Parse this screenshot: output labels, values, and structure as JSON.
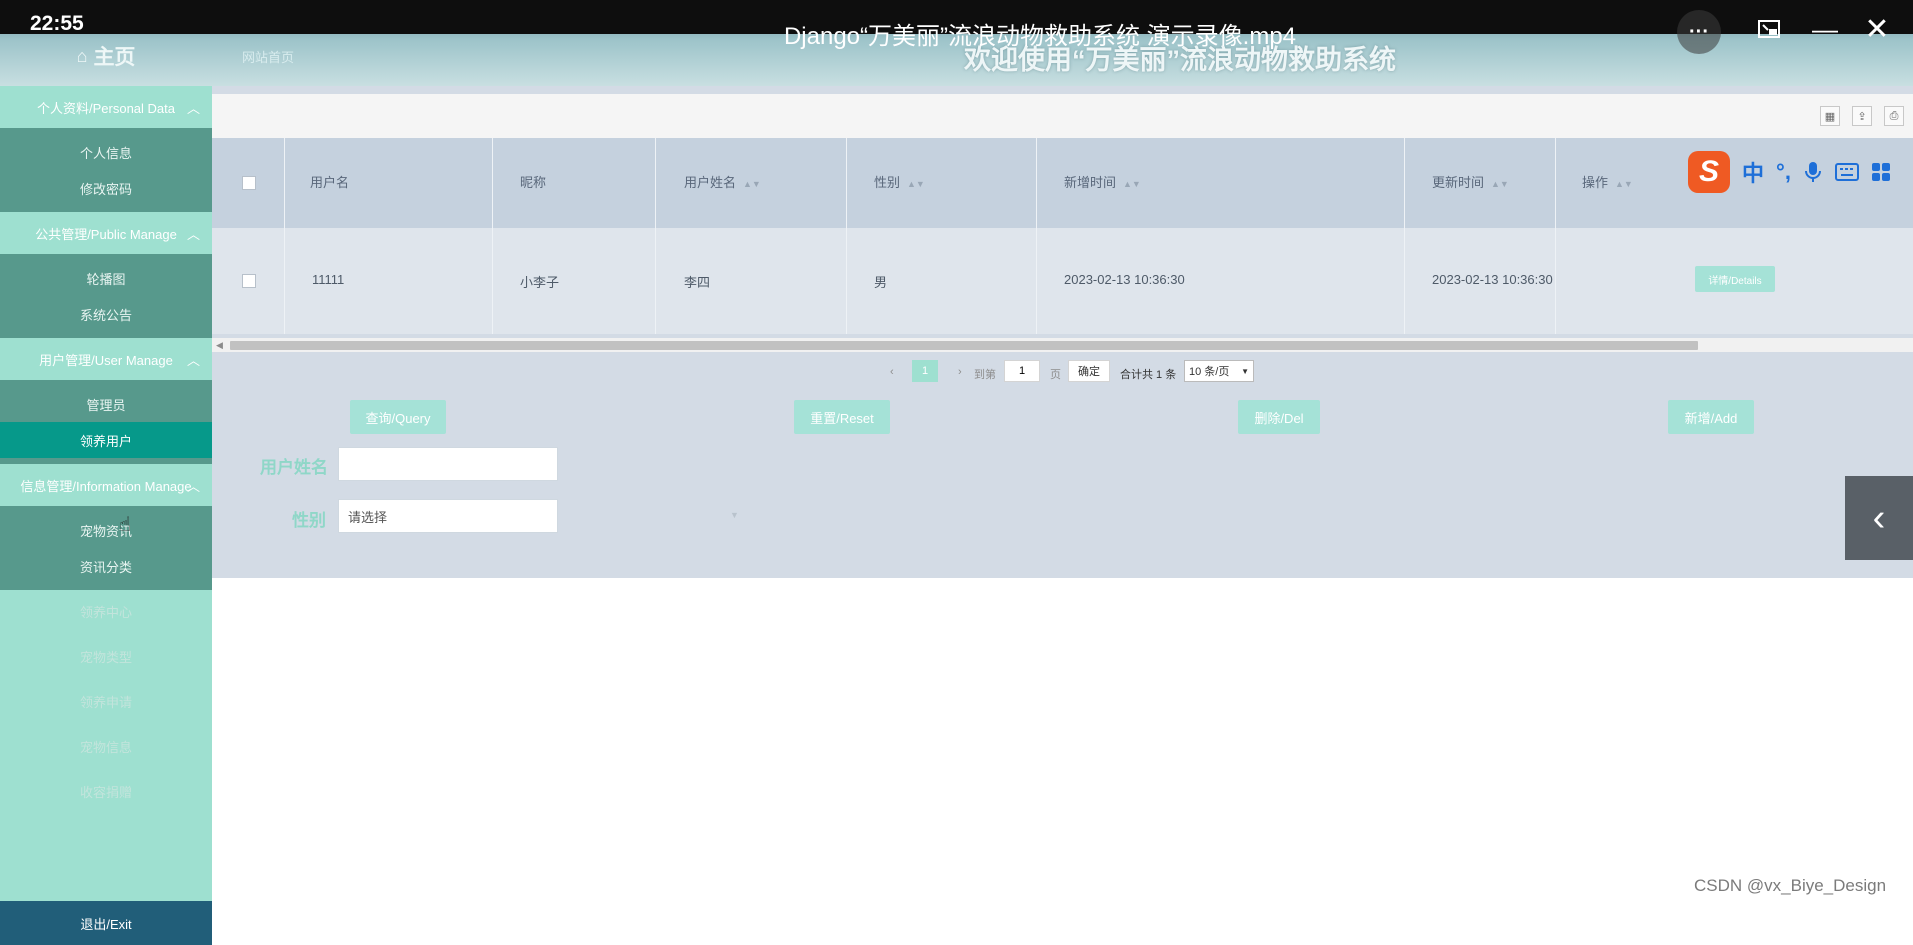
{
  "player": {
    "time": "22:55",
    "title": "Django“万美丽”流浪动物救助系统 演示录像.mp4",
    "more": "···"
  },
  "header": {
    "home": "主页",
    "site_home": "网站首页",
    "title": "欢迎使用“万美丽”流浪动物救助系统"
  },
  "sidebar": {
    "groups": [
      {
        "label": "个人资料/Personal Data",
        "items": [
          "个人信息",
          "修改密码"
        ]
      },
      {
        "label": "公共管理/Public Manage",
        "items": [
          "轮播图",
          "系统公告"
        ]
      },
      {
        "label": "用户管理/User Manage",
        "items": [
          "管理员",
          "领养用户"
        ]
      },
      {
        "label": "信息管理/Information Manage",
        "items": [
          "宠物资讯",
          "资讯分类"
        ]
      }
    ],
    "plain_items": [
      "领养中心",
      "宠物类型",
      "领养申请",
      "宠物信息",
      "收容捐赠"
    ],
    "exit": "退出/Exit",
    "active_item": "领养用户"
  },
  "table": {
    "columns": [
      "用户名",
      "昵称",
      "用户姓名",
      "性别",
      "新增时间",
      "更新时间",
      "操作"
    ],
    "rows": [
      {
        "username": "11111",
        "nickname": "小李子",
        "real_name": "李四",
        "gender": "男",
        "created": "2023-02-13 10:36:30",
        "updated": "2023-02-13 10:36:30",
        "action": "详情/Details"
      }
    ]
  },
  "pager": {
    "prev": "‹",
    "current": "1",
    "next": "›",
    "goto_label": "到第",
    "goto_value": "1",
    "page_unit": "页",
    "confirm": "确定",
    "total": "合计共 1 条",
    "page_size": "10 条/页"
  },
  "actions": {
    "query": "查询/Query",
    "reset": "重置/Reset",
    "delete": "删除/Del",
    "add": "新增/Add"
  },
  "form": {
    "name_label": "用户姓名",
    "name_value": "",
    "gender_label": "性别",
    "gender_placeholder": "请选择"
  },
  "ime": {
    "lang": "中",
    "punct": "°,"
  },
  "watermark": "CSDN @vx_Biye_Design",
  "colors": {
    "sidebar": "#9ee0d0",
    "sidebar_submenu": "#57998c",
    "active": "#06998a",
    "exit": "#215e79",
    "button": "#a5e2d7"
  }
}
